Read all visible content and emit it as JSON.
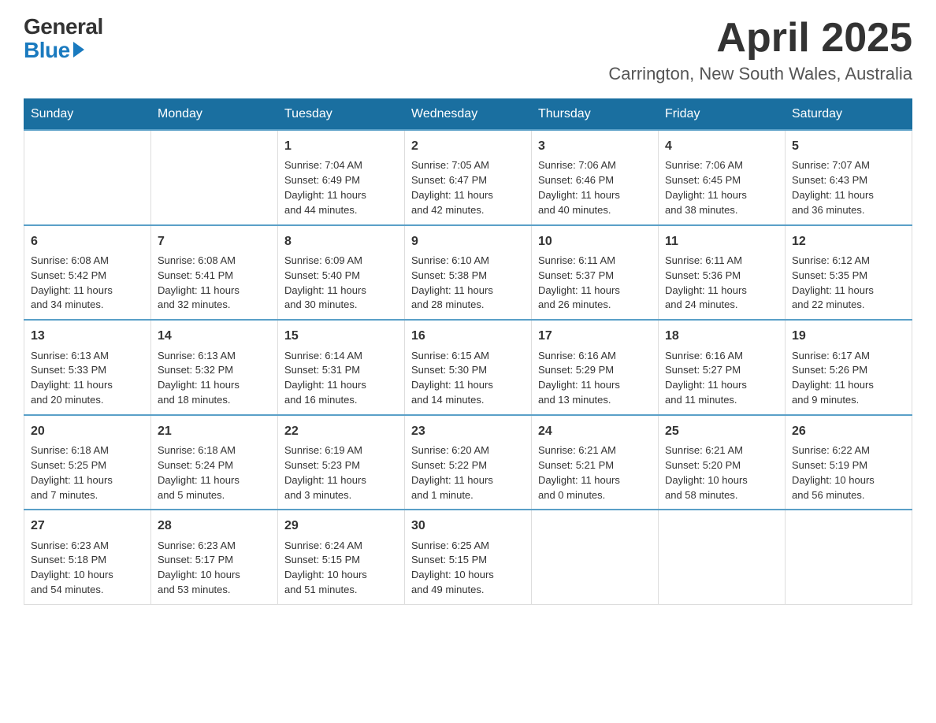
{
  "logo": {
    "general": "General",
    "blue": "Blue"
  },
  "title": {
    "month_year": "April 2025",
    "location": "Carrington, New South Wales, Australia"
  },
  "weekdays": [
    "Sunday",
    "Monday",
    "Tuesday",
    "Wednesday",
    "Thursday",
    "Friday",
    "Saturday"
  ],
  "weeks": [
    [
      {
        "day": "",
        "info": ""
      },
      {
        "day": "",
        "info": ""
      },
      {
        "day": "1",
        "info": "Sunrise: 7:04 AM\nSunset: 6:49 PM\nDaylight: 11 hours\nand 44 minutes."
      },
      {
        "day": "2",
        "info": "Sunrise: 7:05 AM\nSunset: 6:47 PM\nDaylight: 11 hours\nand 42 minutes."
      },
      {
        "day": "3",
        "info": "Sunrise: 7:06 AM\nSunset: 6:46 PM\nDaylight: 11 hours\nand 40 minutes."
      },
      {
        "day": "4",
        "info": "Sunrise: 7:06 AM\nSunset: 6:45 PM\nDaylight: 11 hours\nand 38 minutes."
      },
      {
        "day": "5",
        "info": "Sunrise: 7:07 AM\nSunset: 6:43 PM\nDaylight: 11 hours\nand 36 minutes."
      }
    ],
    [
      {
        "day": "6",
        "info": "Sunrise: 6:08 AM\nSunset: 5:42 PM\nDaylight: 11 hours\nand 34 minutes."
      },
      {
        "day": "7",
        "info": "Sunrise: 6:08 AM\nSunset: 5:41 PM\nDaylight: 11 hours\nand 32 minutes."
      },
      {
        "day": "8",
        "info": "Sunrise: 6:09 AM\nSunset: 5:40 PM\nDaylight: 11 hours\nand 30 minutes."
      },
      {
        "day": "9",
        "info": "Sunrise: 6:10 AM\nSunset: 5:38 PM\nDaylight: 11 hours\nand 28 minutes."
      },
      {
        "day": "10",
        "info": "Sunrise: 6:11 AM\nSunset: 5:37 PM\nDaylight: 11 hours\nand 26 minutes."
      },
      {
        "day": "11",
        "info": "Sunrise: 6:11 AM\nSunset: 5:36 PM\nDaylight: 11 hours\nand 24 minutes."
      },
      {
        "day": "12",
        "info": "Sunrise: 6:12 AM\nSunset: 5:35 PM\nDaylight: 11 hours\nand 22 minutes."
      }
    ],
    [
      {
        "day": "13",
        "info": "Sunrise: 6:13 AM\nSunset: 5:33 PM\nDaylight: 11 hours\nand 20 minutes."
      },
      {
        "day": "14",
        "info": "Sunrise: 6:13 AM\nSunset: 5:32 PM\nDaylight: 11 hours\nand 18 minutes."
      },
      {
        "day": "15",
        "info": "Sunrise: 6:14 AM\nSunset: 5:31 PM\nDaylight: 11 hours\nand 16 minutes."
      },
      {
        "day": "16",
        "info": "Sunrise: 6:15 AM\nSunset: 5:30 PM\nDaylight: 11 hours\nand 14 minutes."
      },
      {
        "day": "17",
        "info": "Sunrise: 6:16 AM\nSunset: 5:29 PM\nDaylight: 11 hours\nand 13 minutes."
      },
      {
        "day": "18",
        "info": "Sunrise: 6:16 AM\nSunset: 5:27 PM\nDaylight: 11 hours\nand 11 minutes."
      },
      {
        "day": "19",
        "info": "Sunrise: 6:17 AM\nSunset: 5:26 PM\nDaylight: 11 hours\nand 9 minutes."
      }
    ],
    [
      {
        "day": "20",
        "info": "Sunrise: 6:18 AM\nSunset: 5:25 PM\nDaylight: 11 hours\nand 7 minutes."
      },
      {
        "day": "21",
        "info": "Sunrise: 6:18 AM\nSunset: 5:24 PM\nDaylight: 11 hours\nand 5 minutes."
      },
      {
        "day": "22",
        "info": "Sunrise: 6:19 AM\nSunset: 5:23 PM\nDaylight: 11 hours\nand 3 minutes."
      },
      {
        "day": "23",
        "info": "Sunrise: 6:20 AM\nSunset: 5:22 PM\nDaylight: 11 hours\nand 1 minute."
      },
      {
        "day": "24",
        "info": "Sunrise: 6:21 AM\nSunset: 5:21 PM\nDaylight: 11 hours\nand 0 minutes."
      },
      {
        "day": "25",
        "info": "Sunrise: 6:21 AM\nSunset: 5:20 PM\nDaylight: 10 hours\nand 58 minutes."
      },
      {
        "day": "26",
        "info": "Sunrise: 6:22 AM\nSunset: 5:19 PM\nDaylight: 10 hours\nand 56 minutes."
      }
    ],
    [
      {
        "day": "27",
        "info": "Sunrise: 6:23 AM\nSunset: 5:18 PM\nDaylight: 10 hours\nand 54 minutes."
      },
      {
        "day": "28",
        "info": "Sunrise: 6:23 AM\nSunset: 5:17 PM\nDaylight: 10 hours\nand 53 minutes."
      },
      {
        "day": "29",
        "info": "Sunrise: 6:24 AM\nSunset: 5:15 PM\nDaylight: 10 hours\nand 51 minutes."
      },
      {
        "day": "30",
        "info": "Sunrise: 6:25 AM\nSunset: 5:15 PM\nDaylight: 10 hours\nand 49 minutes."
      },
      {
        "day": "",
        "info": ""
      },
      {
        "day": "",
        "info": ""
      },
      {
        "day": "",
        "info": ""
      }
    ]
  ]
}
